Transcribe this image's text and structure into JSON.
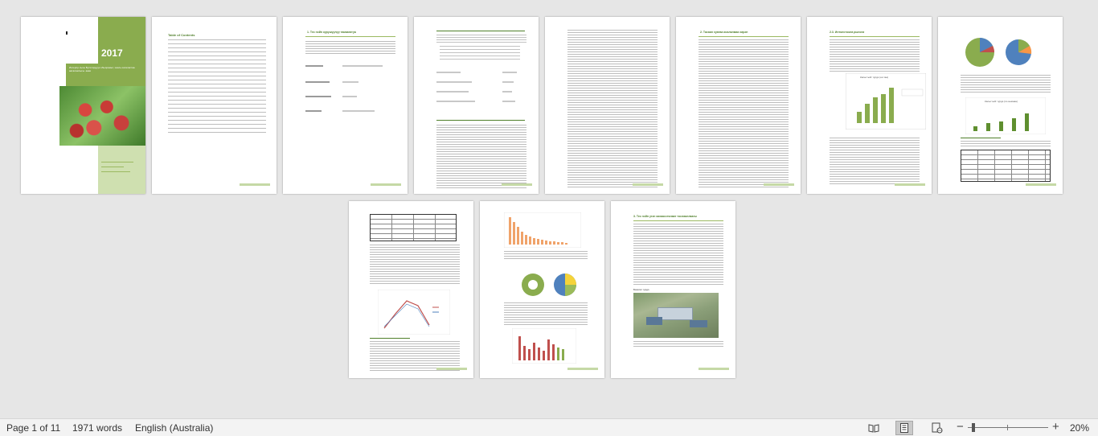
{
  "cover": {
    "year": "2017",
    "subtitle": "Интерпр-лыгы Бутилордуук обыорамыт, хаиль колаластаа ааталамлыгы. ааак"
  },
  "toc": {
    "title": "Table of Contents"
  },
  "pages": {
    "p3_heading": "1. Тес нэйн күрүшүүлүү тамаагатуа",
    "p6_heading": "2. Тасаан хуатаа исалалмаа хирэп",
    "p8_heading": "2.3. Интолстоола рыноги",
    "p11_heading": "3. Тес нэйн угэн кахаассталаат тослааллаагы",
    "p11_caption": "Базатат түрдэ"
  },
  "charts": {
    "p8_bar_title": "Калыгтыйг түрдэ (ни таа)",
    "p9_bar_title": "Калыгтыйг түрдэ (по кымнаа)"
  },
  "status": {
    "page_of": "Page 1 of 11",
    "words": "1971 words",
    "language": "English (Australia)",
    "zoom": "20%",
    "zoom_level": 0.2
  },
  "icons": {
    "read_mode": "read-mode-icon",
    "print_layout": "print-layout-icon",
    "web_layout": "web-layout-icon"
  },
  "colors": {
    "accent_green": "#8aac4e",
    "heading_green": "#4f7f2a",
    "background": "#e6e6e6"
  }
}
